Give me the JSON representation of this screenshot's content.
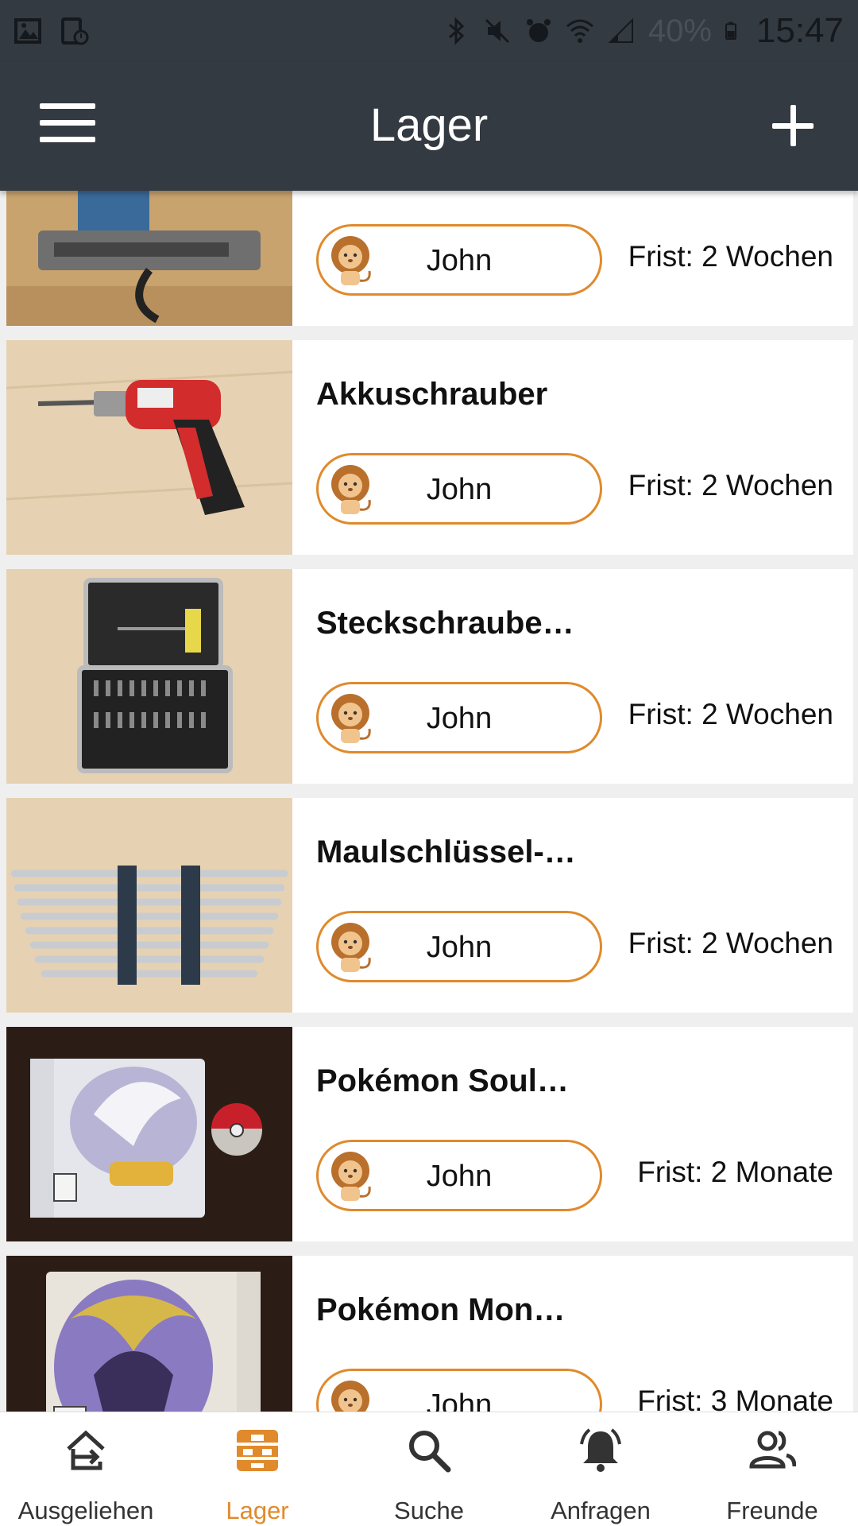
{
  "status_bar": {
    "battery": "40%",
    "time": "15:47",
    "icons_left": [
      "gallery-icon",
      "screenshot-icon"
    ],
    "icons_right": [
      "bluetooth-icon",
      "mute-icon",
      "alarm-icon",
      "wifi-icon",
      "signal-icon",
      "battery-icon"
    ]
  },
  "app_bar": {
    "title": "Lager",
    "menu_icon": "hamburger-menu-icon",
    "add_icon": "plus-icon"
  },
  "colors": {
    "app_bar_bg": "#343a42",
    "accent": "#e08a2c",
    "list_bg": "#efefef",
    "card_bg": "#ffffff"
  },
  "items": [
    {
      "title": "",
      "owner": "John",
      "deadline": "Frist: 2 Wochen",
      "image": "jigsaw-photo"
    },
    {
      "title": "Akkuschrauber",
      "owner": "John",
      "deadline": "Frist: 2 Wochen",
      "image": "cordless-screwdriver-photo"
    },
    {
      "title": "Steckschraube…",
      "owner": "John",
      "deadline": "Frist: 2 Wochen",
      "image": "bit-set-case-photo"
    },
    {
      "title": "Maulschlüssel-…",
      "owner": "John",
      "deadline": "Frist: 2 Wochen",
      "image": "wrench-set-photo"
    },
    {
      "title": "Pokémon Soul…",
      "owner": "John",
      "deadline": "Frist: 2 Monate",
      "image": "pokemon-soulsilver-photo"
    },
    {
      "title": "Pokémon Mon…",
      "owner": "John",
      "deadline": "Frist: 3 Monate",
      "image": "pokemon-moon-photo"
    }
  ],
  "bottom_nav": [
    {
      "label": "Ausgeliehen",
      "icon": "borrowed-icon",
      "active": false
    },
    {
      "label": "Lager",
      "icon": "storage-icon",
      "active": true
    },
    {
      "label": "Suche",
      "icon": "search-icon",
      "active": false
    },
    {
      "label": "Anfragen",
      "icon": "bell-icon",
      "active": false
    },
    {
      "label": "Freunde",
      "icon": "friends-icon",
      "active": false
    }
  ]
}
